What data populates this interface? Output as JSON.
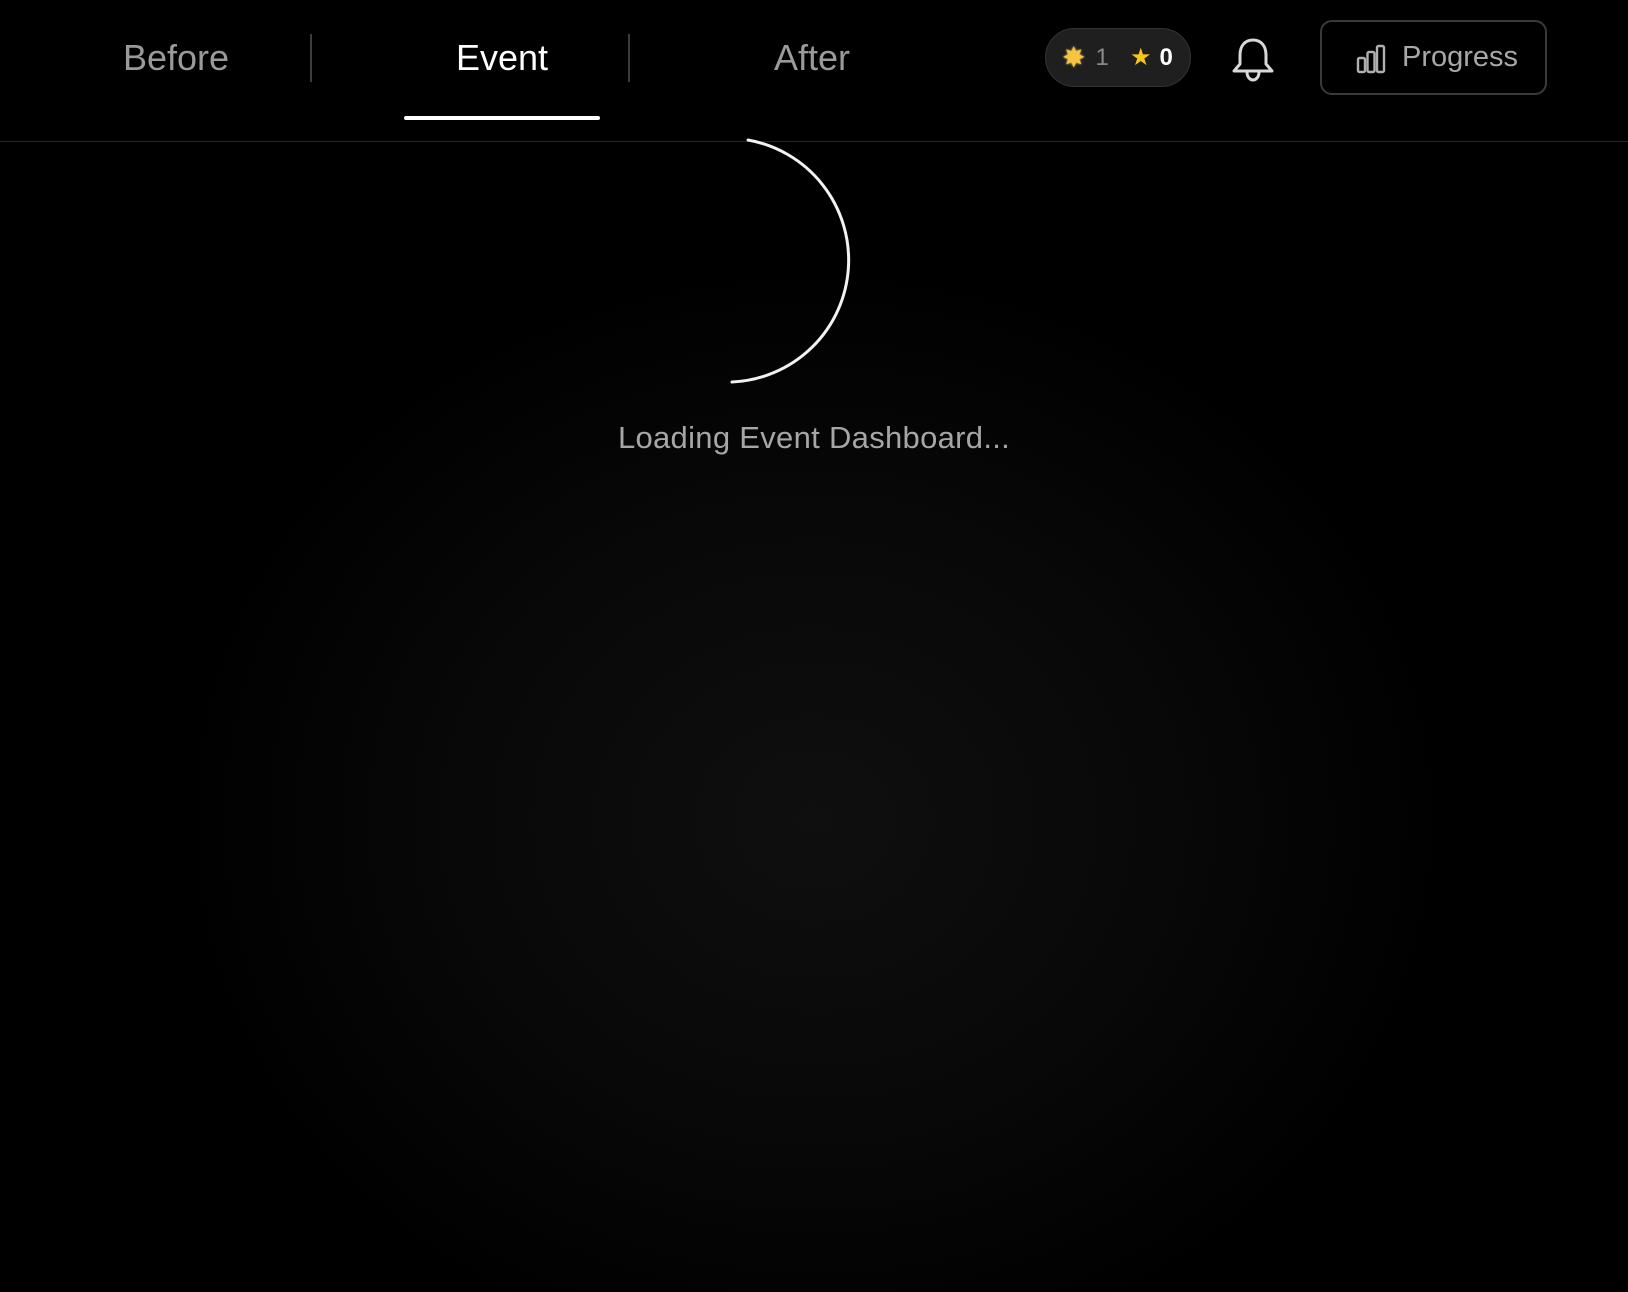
{
  "nav": {
    "tabs": [
      {
        "label": "Before",
        "active": false
      },
      {
        "label": "Event",
        "active": true
      },
      {
        "label": "After",
        "active": false
      }
    ]
  },
  "stats": {
    "first": {
      "icon": "sparkle-star-icon",
      "value": "1"
    },
    "second": {
      "icon": "star-icon",
      "value": "0"
    }
  },
  "notifications": {
    "icon": "bell-icon"
  },
  "progress_button": {
    "label": "Progress",
    "icon": "bar-chart-icon"
  },
  "loading": {
    "text": "Loading Event Dashboard..."
  },
  "colors": {
    "background": "#000000",
    "active_tab": "#ffffff",
    "inactive_tab": "#9a9a9a",
    "star": "#f7c51a"
  }
}
